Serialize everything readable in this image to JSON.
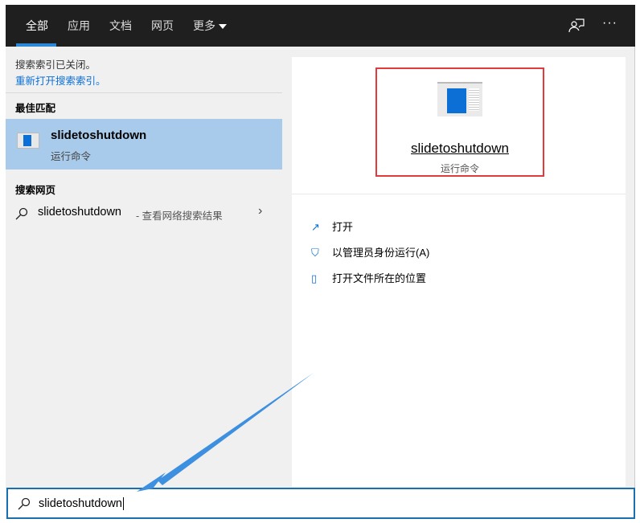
{
  "header": {
    "tabs": [
      "全部",
      "应用",
      "文档",
      "网页",
      "更多"
    ]
  },
  "left": {
    "index_notice": "搜索索引已关闭。",
    "reopen_link": "重新打开搜索索引。",
    "best_match_heading": "最佳匹配",
    "best_match": {
      "title": "slidetoshutdown",
      "subtitle": "运行命令"
    },
    "web_heading": "搜索网页",
    "web_item": {
      "query": "slidetoshutdown",
      "suffix": " - 查看网络搜索结果"
    }
  },
  "right": {
    "title": "slidetoshutdown",
    "subtitle": "运行命令",
    "actions": [
      "打开",
      "以管理员身份运行(A)",
      "打开文件所在的位置"
    ]
  },
  "search": {
    "value": "slidetoshutdown"
  },
  "colors": {
    "accent": "#0b6fd6",
    "highlight": "#a9cbeb",
    "annotation": "#e23b3b",
    "arrow": "#3d8fe0"
  }
}
